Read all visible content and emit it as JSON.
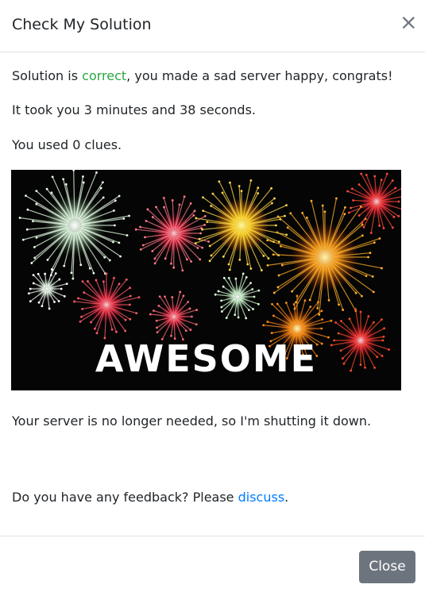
{
  "modal": {
    "title": "Check My Solution",
    "close_symbol": "×",
    "close_icon": "close-icon"
  },
  "body": {
    "result_prefix": "Solution is ",
    "result_word": "correct",
    "result_suffix": ", you made a sad server happy, congrats!",
    "time_text": "It took you 3 minutes and 38 seconds.",
    "clues_text": "You used 0 clues.",
    "image_caption": "AWESOME",
    "shutdown_text": "Your server is no longer needed, so I'm shutting it down.",
    "feedback_prefix": "Do you have any feedback? Please ",
    "feedback_link": "discuss",
    "feedback_suffix": "."
  },
  "footer": {
    "close_label": "Close"
  },
  "colors": {
    "success": "#28a745",
    "link": "#007bff",
    "secondary_button": "#6c757d"
  }
}
